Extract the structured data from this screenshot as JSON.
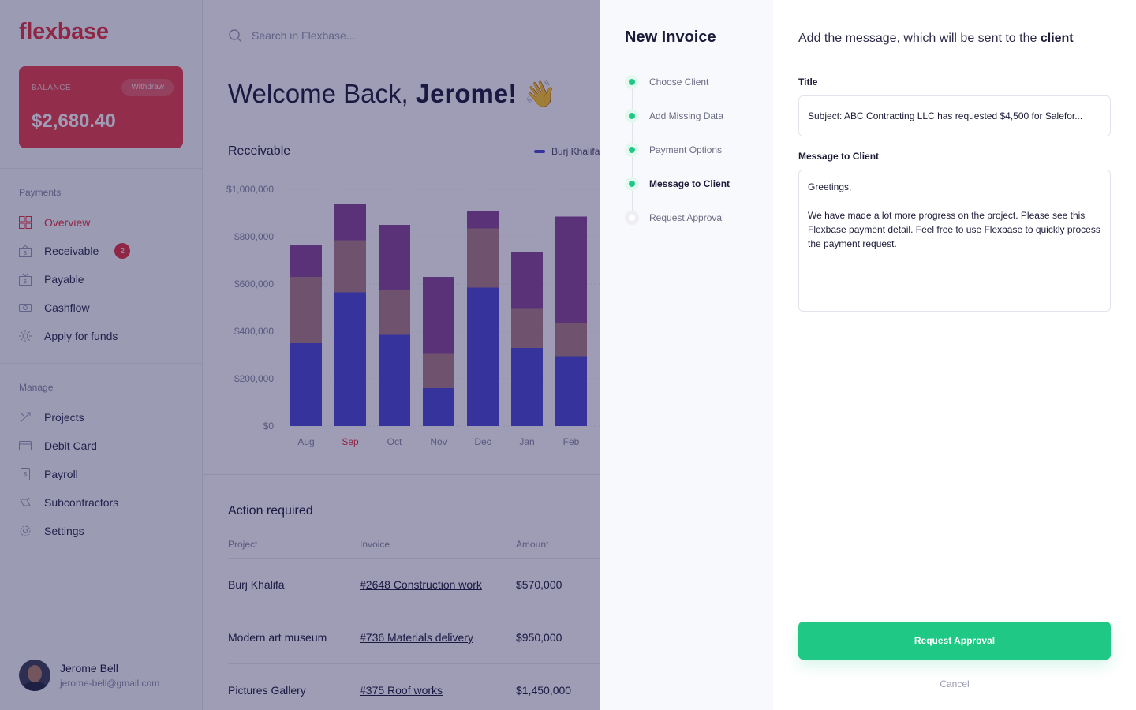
{
  "app": {
    "logo": "flexbase",
    "balance": {
      "label": "BALANCE",
      "withdraw": "Withdraw",
      "value": "$2,680.40"
    },
    "sidebar": {
      "payments_label": "Payments",
      "payments": [
        {
          "label": "Overview",
          "icon": "grid-icon",
          "active": true
        },
        {
          "label": "Receivable",
          "icon": "receivable-icon",
          "badge": "2"
        },
        {
          "label": "Payable",
          "icon": "payable-icon"
        },
        {
          "label": "Cashflow",
          "icon": "cashflow-icon"
        },
        {
          "label": "Apply for funds",
          "icon": "funds-icon"
        }
      ],
      "manage_label": "Manage",
      "manage": [
        {
          "label": "Projects",
          "icon": "projects-icon"
        },
        {
          "label": "Debit Card",
          "icon": "card-icon"
        },
        {
          "label": "Payroll",
          "icon": "payroll-icon"
        },
        {
          "label": "Subcontractors",
          "icon": "subcontractors-icon"
        },
        {
          "label": "Settings",
          "icon": "gear-icon"
        }
      ]
    },
    "user": {
      "name": "Jerome Bell",
      "email": "jerome-bell@gmail.com"
    },
    "search": {
      "placeholder": "Search in Flexbase..."
    },
    "welcome": {
      "text": "Welcome Back, ",
      "name": "Jerome!",
      "emoji": "👋"
    },
    "receivable_title": "Receivable",
    "legend_first": "Burj Khalifa",
    "action": {
      "title": "Action required",
      "columns": [
        "Project",
        "Invoice",
        "Amount"
      ],
      "rows": [
        {
          "project": "Burj Khalifa",
          "invoice": "#2648 Construction work",
          "amount": "$570,000"
        },
        {
          "project": "Modern art museum",
          "invoice": "#736 Materials delivery",
          "amount": "$950,000"
        },
        {
          "project": "Pictures Gallery",
          "invoice": "#375 Roof works",
          "amount": "$1,450,000"
        }
      ]
    }
  },
  "chart_data": {
    "type": "bar",
    "stacked": true,
    "categories": [
      "Aug",
      "Sep",
      "Oct",
      "Nov",
      "Dec",
      "Jan",
      "Feb"
    ],
    "highlight_category": "Sep",
    "series": [
      {
        "name": "Burj Khalifa",
        "color": "#4e49d6",
        "values": [
          350000,
          565000,
          385000,
          160000,
          585000,
          330000,
          295000
        ]
      },
      {
        "color": "#ad7f85",
        "values": [
          280000,
          220000,
          190000,
          145000,
          250000,
          165000,
          140000
        ]
      },
      {
        "color": "#8a4796",
        "values": [
          135000,
          155000,
          275000,
          325000,
          75000,
          240000,
          450000
        ]
      }
    ],
    "ylim": [
      0,
      1000000
    ],
    "yticks": [
      "$0",
      "$200,000",
      "$400,000",
      "$600,000",
      "$800,000",
      "$1,000,000"
    ],
    "grid": true
  },
  "wizard": {
    "title": "New Invoice",
    "steps": [
      {
        "label": "Choose Client",
        "state": "done"
      },
      {
        "label": "Add Missing Data",
        "state": "done"
      },
      {
        "label": "Payment Options",
        "state": "done"
      },
      {
        "label": "Message to Client",
        "state": "current"
      },
      {
        "label": "Request Approval",
        "state": "todo"
      }
    ],
    "heading_prefix": "Add the message, which will be sent to the ",
    "heading_bold": "client",
    "title_label": "Title",
    "title_value": "Subject: ABC Contracting LLC has requested $4,500 for Salefor...",
    "message_label": "Message to Client",
    "message_value": "Greetings,\n\nWe have made a lot more progress on the project. Please see this Flexbase payment detail. Feel free to use Flexbase to quickly process the payment request.",
    "primary": "Request Approval",
    "cancel": "Cancel"
  }
}
